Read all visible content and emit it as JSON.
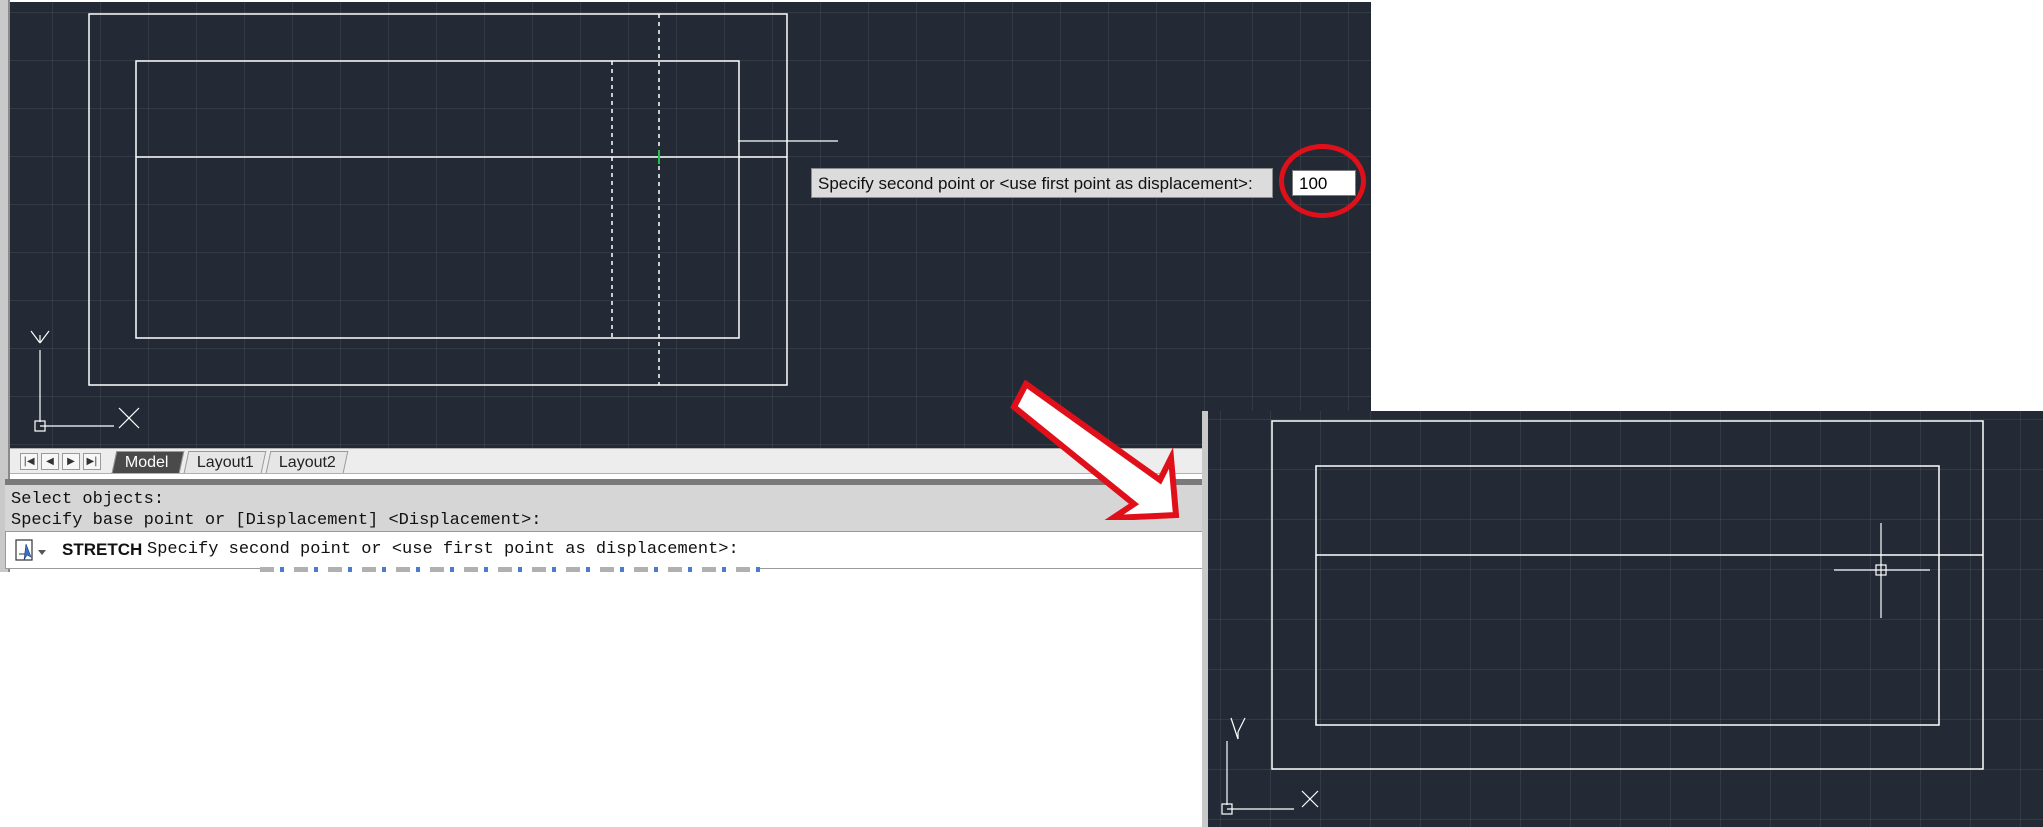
{
  "left_window": {
    "dynamic_input": {
      "prompt": "Specify second point or <use first point as displacement>:",
      "value": "100"
    },
    "ucs": {
      "y_label": "Y",
      "x_label": "X"
    },
    "tabs": [
      {
        "label": "Model",
        "active": true
      },
      {
        "label": "Layout1",
        "active": false
      },
      {
        "label": "Layout2",
        "active": false
      }
    ],
    "nav_buttons": [
      "first-tab",
      "previous-tab",
      "next-tab",
      "last-tab"
    ],
    "command_history": [
      "Select objects:",
      "Specify base point or [Displacement] <Displacement>:"
    ],
    "command_line": {
      "command": "STRETCH",
      "prompt": "Specify second point or <use first point as displacement>:"
    }
  },
  "right_window": {
    "ucs": {
      "y_label": "Y",
      "x_label": "X"
    }
  },
  "colors": {
    "viewport_bg": "#232a35",
    "highlight": "#e0101a",
    "arrow": "#e0101a"
  }
}
